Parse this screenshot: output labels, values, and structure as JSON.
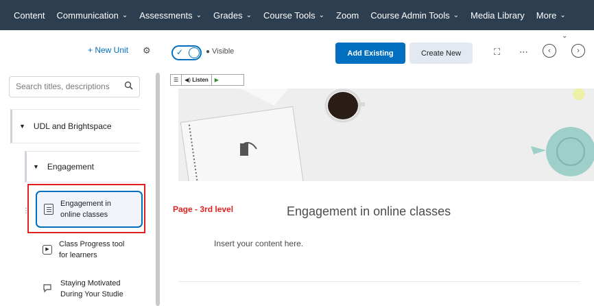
{
  "nav": {
    "items": [
      {
        "label": "Content",
        "dropdown": false
      },
      {
        "label": "Communication",
        "dropdown": true
      },
      {
        "label": "Assessments",
        "dropdown": true
      },
      {
        "label": "Grades",
        "dropdown": true
      },
      {
        "label": "Course Tools",
        "dropdown": true
      },
      {
        "label": "Zoom",
        "dropdown": false
      },
      {
        "label": "Course Admin Tools",
        "dropdown": true
      },
      {
        "label": "Media Library",
        "dropdown": false
      },
      {
        "label": "More",
        "dropdown": true
      }
    ],
    "dropdown_glyph": "⌄"
  },
  "sidebar": {
    "new_unit_label": "+ New Unit",
    "search_placeholder": "Search titles, descriptions",
    "unit1": "UDL and Brightspace",
    "unit2": "Engagement",
    "selected_item_line1": "Engagement in",
    "selected_item_line2": "online classes",
    "item2_line1": "Class Progress tool",
    "item2_line2": "for learners",
    "item3_line1": "Staying Motivated",
    "item3_line2": "During Your Studie"
  },
  "toolbar": {
    "visible_label": "Visible",
    "add_existing_label": "Add Existing",
    "create_new_label": "Create New"
  },
  "readspeaker": {
    "listen_label": "Listen"
  },
  "main": {
    "page_level_annotation": "Page - 3rd level",
    "title": "Engagement in online classes",
    "placeholder_text": "Insert your content here."
  },
  "colors": {
    "nav_bg": "#2d3e50",
    "accent": "#006fbf",
    "annotation_red": "#e02020",
    "teapot": "#9ecfc9"
  }
}
